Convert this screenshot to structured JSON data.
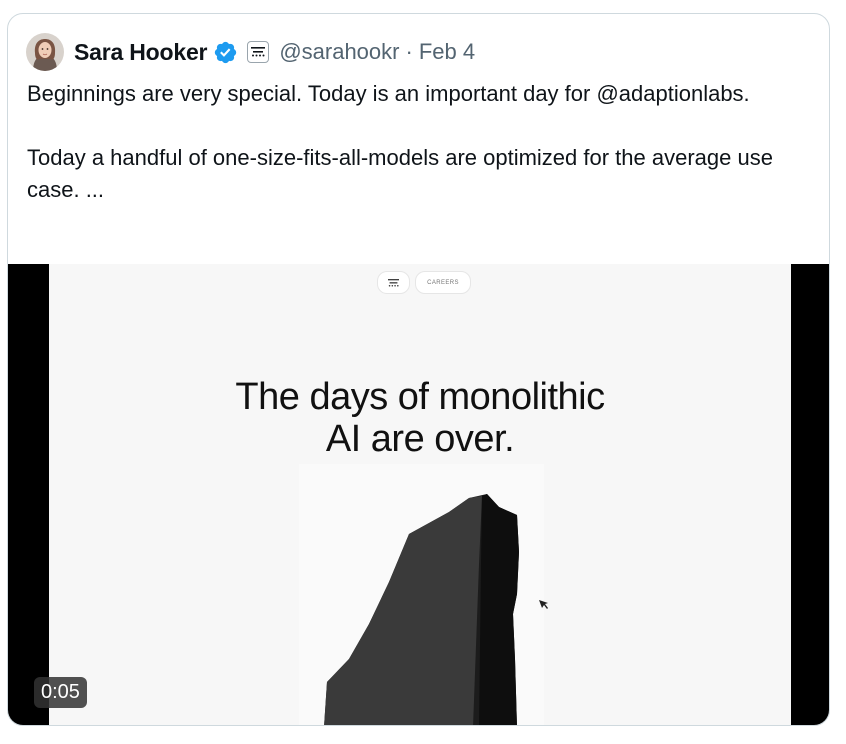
{
  "tweet": {
    "author_name": "Sara Hooker",
    "handle": "@sarahookr",
    "separator": "·",
    "date": "Feb 4",
    "text_paragraph_1": "Beginnings are very special. Today is an important day for @adaptionlabs.",
    "text_paragraph_2": "Today a handful of one-size-fits-all-models are optimized for the average use case. ...",
    "verified_color": "#1d9bf0"
  },
  "media": {
    "nav_careers_label": "CAREERS",
    "headline_line_1": "The days of monolithic",
    "headline_line_2": "AI are over.",
    "video_duration": "0:05"
  },
  "icons": {
    "avatar": "avatar",
    "verified": "verified-badge-icon",
    "affiliation": "affiliation-logo-icon",
    "cursor": "mouse-cursor-icon"
  }
}
